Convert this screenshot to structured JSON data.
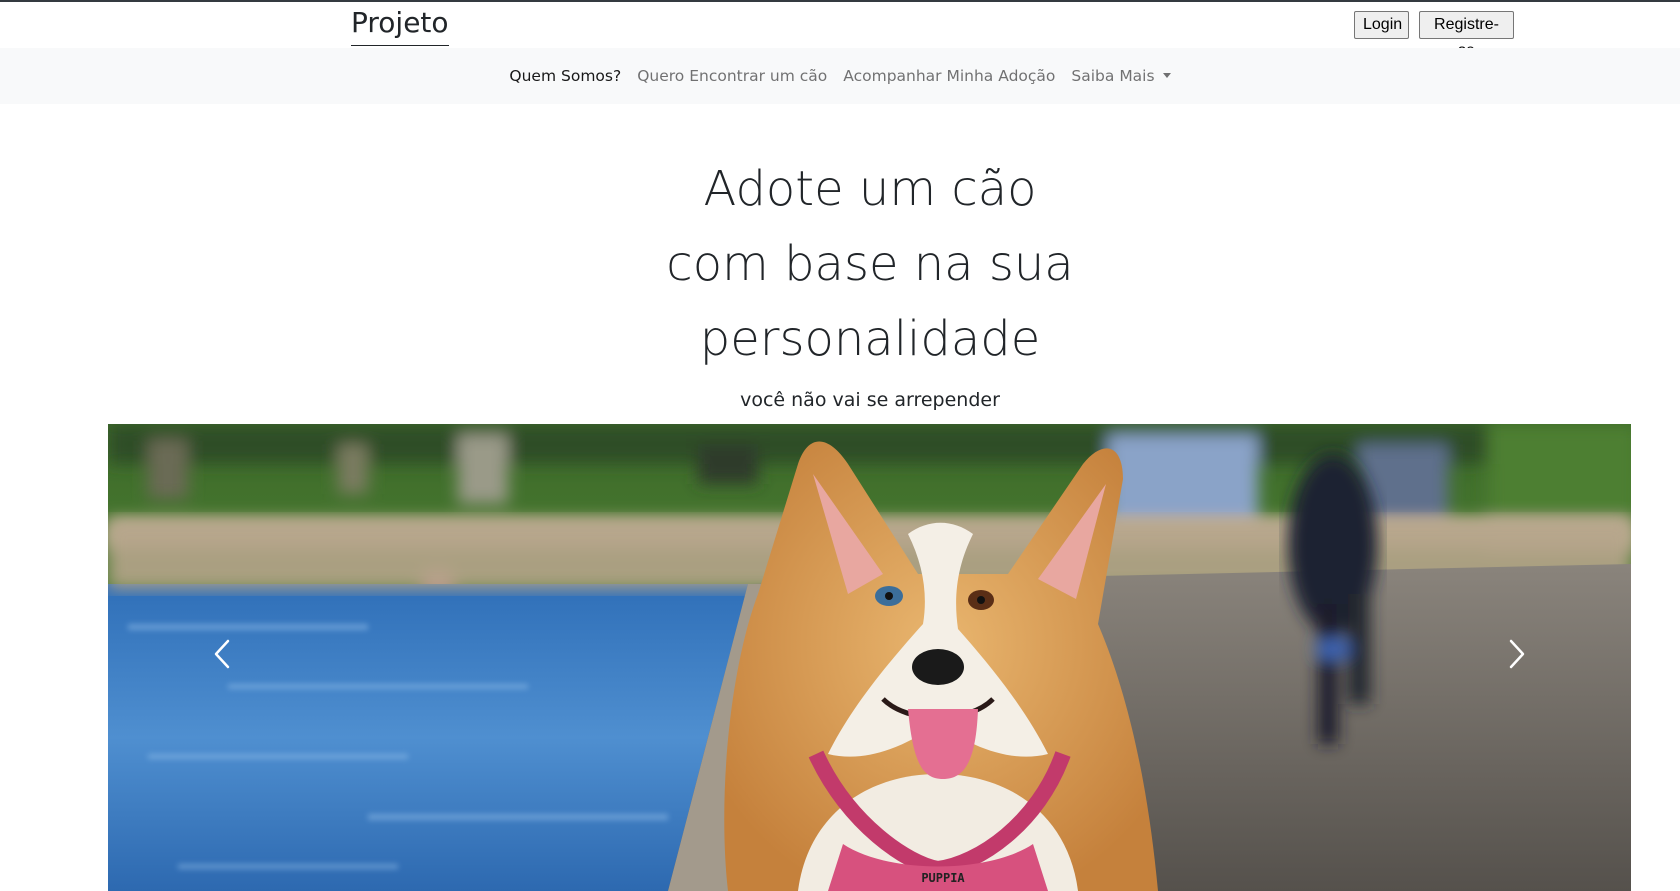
{
  "header": {
    "brand": "Projeto",
    "login_label": "Login",
    "register_label": "Registre-se"
  },
  "nav": {
    "items": [
      {
        "label": "Quem Somos?"
      },
      {
        "label": "Quero Encontrar um cão"
      },
      {
        "label": "Acompanhar Minha Adoção"
      },
      {
        "label": "Saiba Mais"
      }
    ]
  },
  "hero": {
    "title_lines": [
      "Adote um cão",
      "com base na sua",
      "personalidade"
    ],
    "subtitle": "você não vai se arrepender"
  },
  "carousel": {
    "collar_text": "PUPPIA",
    "prev_icon": "chevron-left-icon",
    "next_icon": "chevron-right-icon"
  },
  "colors": {
    "navbar_bg": "#f8f9fa",
    "text": "#212529"
  }
}
